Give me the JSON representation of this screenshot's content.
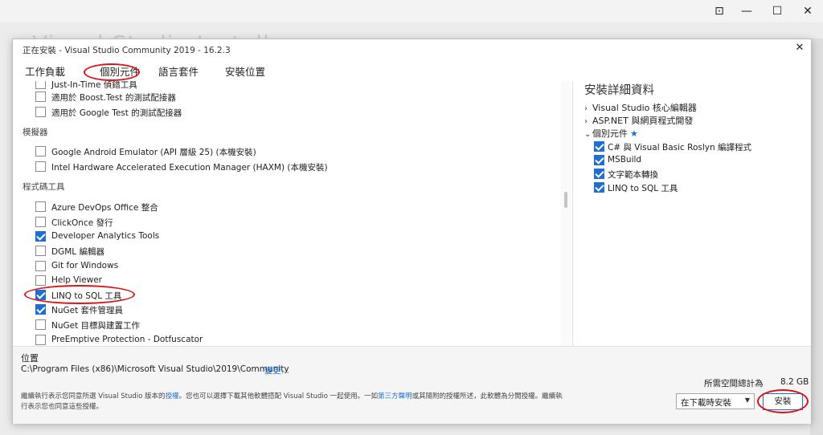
{
  "window_controls": {
    "restore": "⊡",
    "minimize": "—",
    "maximize": "☐",
    "close": "✕"
  },
  "background": {
    "faded_title": "Visual Studio Installer"
  },
  "dialog": {
    "title": "正在安裝 - Visual Studio Community 2019 - 16.2.3",
    "close": "✕",
    "tabs": [
      "工作負載",
      "個別元件",
      "語言套件",
      "安裝位置"
    ]
  },
  "left_list": {
    "top_items": [
      {
        "label": "Just-In-Time 偵錯工具",
        "checked": false
      },
      {
        "label": "適用於 Boost.Test 的測試配接器",
        "checked": false
      },
      {
        "label": "適用於 Google Test 的測試配接器",
        "checked": false
      }
    ],
    "emulator_section": "模擬器",
    "emulator_items": [
      {
        "label": "Google Android Emulator (API 層級 25) (本機安裝)",
        "checked": false
      },
      {
        "label": "Intel Hardware Accelerated Execution Manager (HAXM) (本機安裝)",
        "checked": false
      }
    ],
    "tools_section": "程式碼工具",
    "tools_items": [
      {
        "label": "Azure DevOps Office 整合",
        "checked": false
      },
      {
        "label": "ClickOnce 發行",
        "checked": false
      },
      {
        "label": "Developer Analytics Tools",
        "checked": true
      },
      {
        "label": "DGML 編輯器",
        "checked": false
      },
      {
        "label": "Git for Windows",
        "checked": false
      },
      {
        "label": "Help Viewer",
        "checked": false
      },
      {
        "label": "LINQ to SQL 工具",
        "checked": true
      },
      {
        "label": "NuGet 套件管理員",
        "checked": true
      },
      {
        "label": "NuGet 目標與建置工作",
        "checked": false
      },
      {
        "label": "PreEmptive Protection - Dotfuscator",
        "checked": false
      }
    ]
  },
  "details": {
    "title": "安裝詳細資料",
    "groups": [
      {
        "chevron": "›",
        "label": "Visual Studio 核心編輯器"
      },
      {
        "chevron": "›",
        "label": "ASP.NET 與網頁程式開發"
      },
      {
        "chevron": "⌄",
        "label": "個別元件"
      }
    ],
    "star": "★",
    "components": [
      {
        "label": "C# 與 Visual Basic Roslyn 編譯程式",
        "checked": true
      },
      {
        "label": "MSBuild",
        "checked": true
      },
      {
        "label": "文字範本轉換",
        "checked": true
      },
      {
        "label": "LINQ to SQL 工具",
        "checked": true
      }
    ]
  },
  "footer": {
    "location_label": "位置",
    "location_path": "C:\\Program Files (x86)\\Microsoft Visual Studio\\2019\\Community",
    "change_link": "變更...",
    "license_part1": "繼續執行表示您同意所選 Visual Studio 版本的",
    "license_link1": "授權",
    "license_part2": "。您也可以選擇下載其他軟體搭配 Visual Studio 一起使用。一如",
    "license_link2": "第三方聲明",
    "license_part3": "或其隨附的授權所述，此軟體為分開授權。繼續執行表示您也同意這些授權。",
    "space_label": "所需空間總計為",
    "space_value": "8.2 GB",
    "install_mode": "在下載時安裝",
    "select_arrow": "▼",
    "install_button": "安裝"
  },
  "colors": {
    "accent": "#1e6fd1",
    "annotation": "#d9151b"
  }
}
